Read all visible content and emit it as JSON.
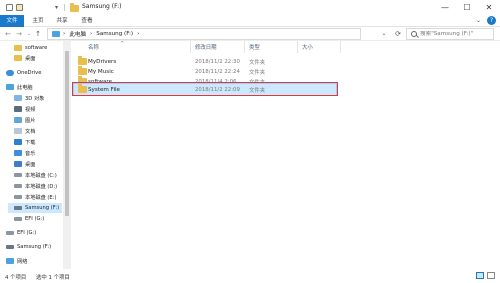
{
  "window": {
    "title": "Samsung (F:)",
    "title_dropdown": "▾",
    "minimize": "—",
    "maximize": "☐",
    "close": "✕"
  },
  "ribbon": {
    "tabs": [
      "文件",
      "主页",
      "共享",
      "查看"
    ],
    "expand_toggle": "⌄",
    "help": "?"
  },
  "address": {
    "back": "←",
    "forward": "→",
    "recent": "⌄",
    "up": "↑",
    "crumbs": [
      "此电脑",
      "›",
      "Samsung (F:)",
      "›"
    ],
    "dropdown": "⌄",
    "refresh": "⟳",
    "search_placeholder": "搜索\"Samsung (F:)\""
  },
  "sidebar": {
    "items": [
      {
        "label": "software",
        "icon": "folder-icon"
      },
      {
        "label": "桌面",
        "icon": "folder-icon"
      },
      {
        "label": "OneDrive",
        "icon": "cloud-icon"
      },
      {
        "label": "此电脑",
        "icon": "computer-icon"
      },
      {
        "label": "3D 对象",
        "icon": "3d-objects-icon"
      },
      {
        "label": "视频",
        "icon": "video-icon"
      },
      {
        "label": "图片",
        "icon": "pictures-icon"
      },
      {
        "label": "文档",
        "icon": "documents-icon"
      },
      {
        "label": "下载",
        "icon": "downloads-icon"
      },
      {
        "label": "音乐",
        "icon": "music-icon"
      },
      {
        "label": "桌面",
        "icon": "desktop-icon"
      },
      {
        "label": "本地磁盘 (C:)",
        "icon": "drive-icon"
      },
      {
        "label": "本地磁盘 (D:)",
        "icon": "drive-icon"
      },
      {
        "label": "本地磁盘 (E:)",
        "icon": "drive-icon"
      },
      {
        "label": "Samsung (F:)",
        "icon": "usb-drive-icon"
      },
      {
        "label": "EFI (G:)",
        "icon": "drive-icon"
      },
      {
        "label": "EFI (G:)",
        "icon": "drive-icon"
      },
      {
        "label": "Samsung (F:)",
        "icon": "usb-drive-icon"
      },
      {
        "label": "网络",
        "icon": "network-icon"
      }
    ]
  },
  "columns": {
    "sort_indicator": "^",
    "name": "名称",
    "date": "修改日期",
    "type": "类型",
    "size": "大小"
  },
  "files": [
    {
      "name": "MyDrivers",
      "date": "2018/11/2 22:30",
      "type": "文件夹"
    },
    {
      "name": "My Music",
      "date": "2018/11/2 22:24",
      "type": "文件夹"
    },
    {
      "name": "software",
      "date": "2018/11/4 2:06",
      "type": "文件夹"
    },
    {
      "name": "System File",
      "date": "2018/11/2 22:09",
      "type": "文件夹"
    }
  ],
  "status": {
    "count": "4 个项目",
    "selected": "选中 1 个项目"
  },
  "colors": {
    "accent": "#1979ca",
    "selection": "#cce8ff",
    "folder": "#e8bf4f",
    "highlight_box": "#e0373d"
  }
}
